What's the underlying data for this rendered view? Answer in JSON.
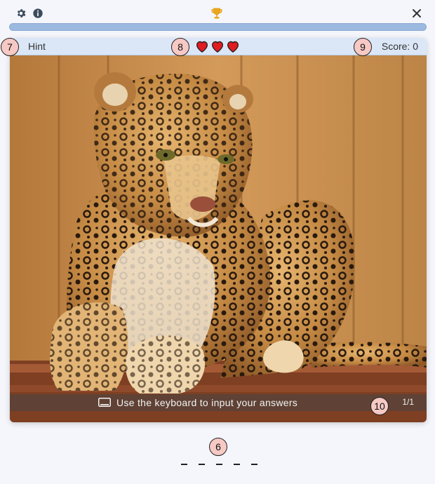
{
  "toolbar": {
    "settings_icon": "gear-icon",
    "info_icon": "info-icon",
    "trophy_icon": "trophy-icon",
    "close_icon": "close-icon",
    "accent_color": "#e9a51d"
  },
  "progress": {
    "fraction": 1.0
  },
  "hint_bar": {
    "hint_label": "Hint",
    "lives": 3,
    "score_text": "Score: 0"
  },
  "photo": {
    "caption": "Use the keyboard to input your answers",
    "counter": "1/1"
  },
  "answer": {
    "slots": 5
  },
  "annotations": [
    "7",
    "8",
    "9",
    "10",
    "6"
  ]
}
